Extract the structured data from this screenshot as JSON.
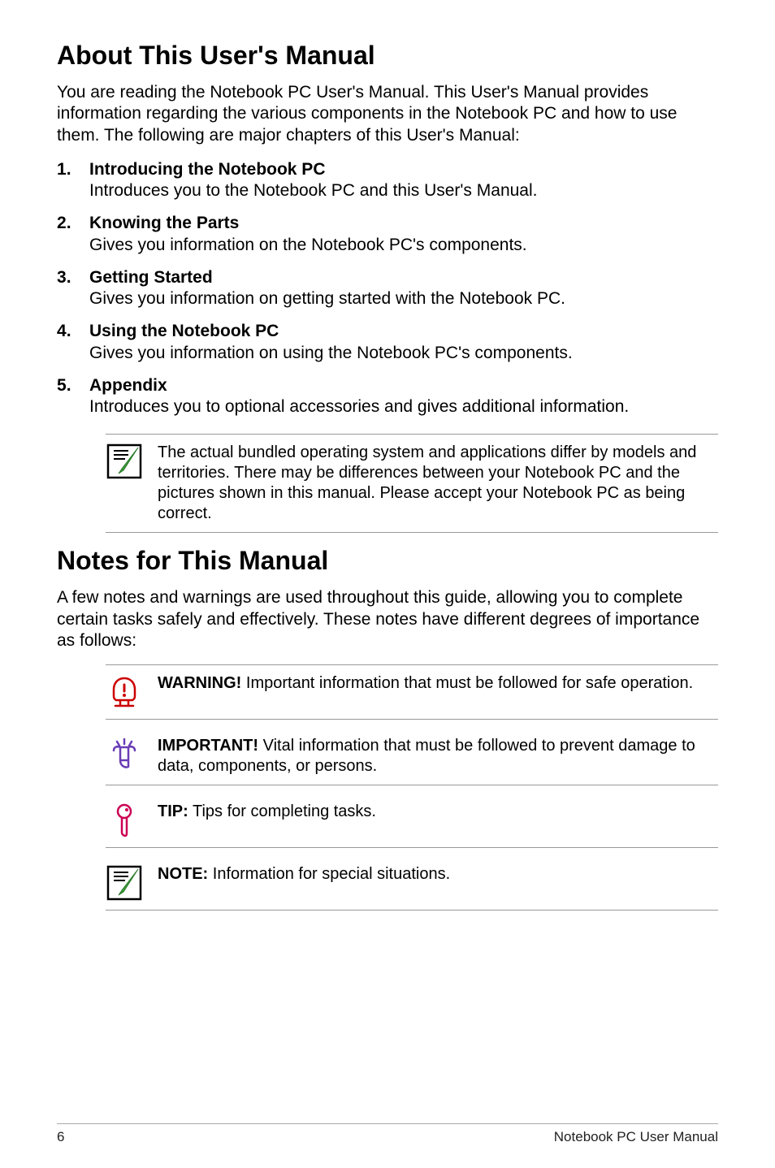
{
  "section1": {
    "heading": "About This User's Manual",
    "intro": "You are reading the Notebook PC User's Manual. This User's Manual provides information regarding the various components in the Notebook PC and how to use them. The following are major chapters of this User's Manual:",
    "chapters": [
      {
        "title": "Introducing the Notebook PC",
        "desc": "Introduces you to the Notebook PC and this User's Manual."
      },
      {
        "title": "Knowing the Parts",
        "desc": "Gives you information on the Notebook PC's components."
      },
      {
        "title": "Getting Started",
        "desc": "Gives you information on getting started with the Notebook PC."
      },
      {
        "title": "Using the Notebook PC",
        "desc": "Gives you information on using the Notebook PC's components."
      },
      {
        "title": "Appendix",
        "desc": "Introduces you to optional accessories and gives additional information."
      }
    ],
    "note_callout": "The actual bundled operating system and applications differ by models and territories. There may be differences between your Notebook PC and the pictures shown in this manual. Please accept your Notebook PC as being correct."
  },
  "section2": {
    "heading": "Notes for This Manual",
    "intro": "A few notes and warnings are used throughout this guide, allowing you to complete certain tasks safely and effectively. These notes have different degrees of importance as follows:",
    "callouts": [
      {
        "label": "WARNING!",
        "text": " Important information that must be followed for safe operation."
      },
      {
        "label": "IMPORTANT!",
        "text": " Vital information that must be followed to prevent damage to data, components, or persons."
      },
      {
        "label": "TIP:",
        "text": " Tips for completing tasks."
      },
      {
        "label": "NOTE:",
        "text": "  Information for special situations."
      }
    ]
  },
  "footer": {
    "page": "6",
    "title": "Notebook PC User Manual"
  }
}
